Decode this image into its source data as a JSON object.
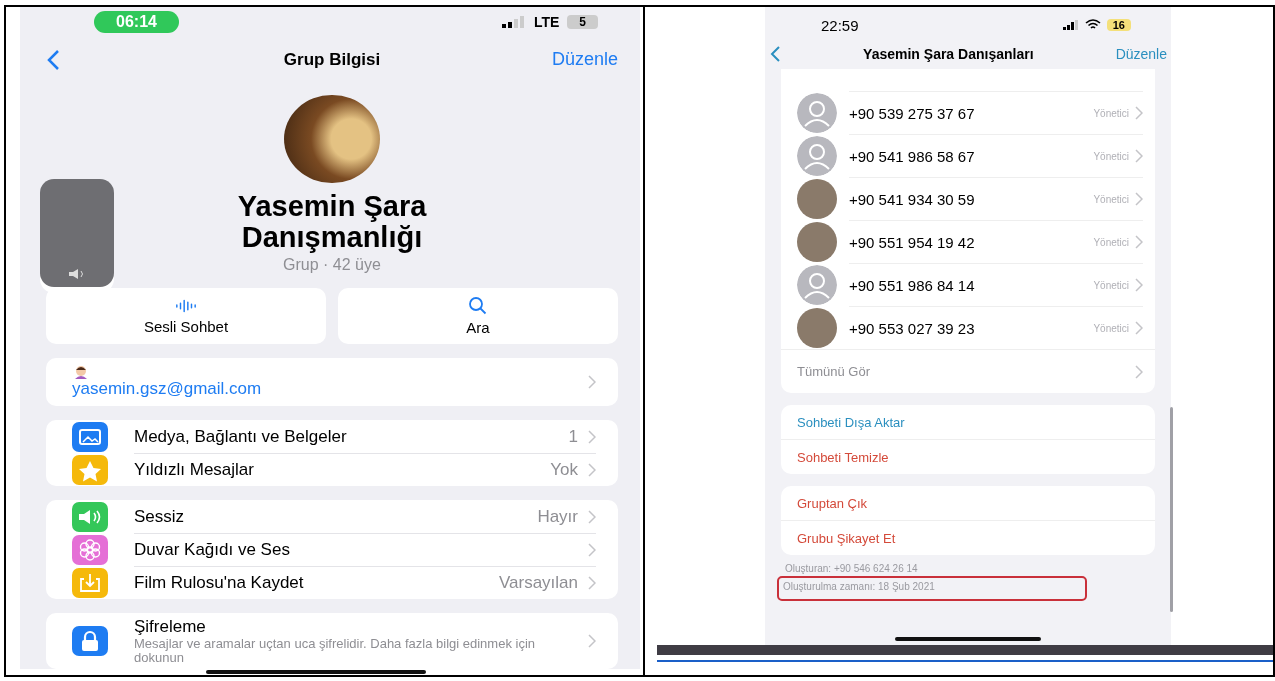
{
  "left_phone": {
    "status_bar": {
      "time": "06:14",
      "network": "LTE",
      "battery": "5"
    },
    "nav": {
      "title": "Grup Bilgisi",
      "action": "Düzenle"
    },
    "group": {
      "name": "Yasemin Şara Danışmanlığı",
      "subtitle": "Grup · 42 üye"
    },
    "quick_actions": [
      {
        "kind": "voice",
        "label": "Sesli Sohbet"
      },
      {
        "kind": "search",
        "label": "Ara"
      }
    ],
    "description": "yasemin.gsz@gmail.com",
    "sections": [
      [
        {
          "kind": "media",
          "label": "Medya, Bağlantı ve Belgeler",
          "value": "1"
        },
        {
          "kind": "star",
          "label": "Yıldızlı Mesajlar",
          "value": "Yok"
        }
      ],
      [
        {
          "kind": "sound",
          "label": "Sessiz",
          "value": "Hayır"
        },
        {
          "kind": "flower",
          "label": "Duvar Kağıdı ve Ses"
        },
        {
          "kind": "save",
          "label": "Film Rulosu'na Kaydet",
          "value": "Varsayılan"
        }
      ]
    ],
    "encryption": {
      "title": "Şifreleme",
      "text": "Mesajlar ve aramalar uçtan uca şifrelidir. Daha fazla bilgi edinmek için dokunun"
    }
  },
  "right_phone": {
    "status_bar": {
      "time": "22:59",
      "battery": "16"
    },
    "nav": {
      "title": "Yasemin Şara Danışanları",
      "action": "Düzenle"
    },
    "members": [
      {
        "has_photo": false,
        "phone": "+90 539 275 37 67",
        "role": "Yönetici"
      },
      {
        "has_photo": false,
        "phone": "+90 541 986 58 67",
        "role": "Yönetici"
      },
      {
        "has_photo": true,
        "phone": "+90 541 934 30 59",
        "role": "Yönetici"
      },
      {
        "has_photo": true,
        "phone": "+90 551 954 19 42",
        "role": "Yönetici"
      },
      {
        "has_photo": false,
        "phone": "+90 551 986 84 14",
        "role": "Yönetici"
      },
      {
        "has_photo": true,
        "phone": "+90 553 027 39 23",
        "role": "Yönetici"
      }
    ],
    "see_all": "Tümünü Gör",
    "action_groups": [
      [
        {
          "kind": "normal",
          "label": "Sohbeti Dışa Aktar"
        },
        {
          "kind": "destructive",
          "label": "Sohbeti Temizle"
        }
      ],
      [
        {
          "kind": "destructive",
          "label": "Gruptan Çık"
        },
        {
          "kind": "destructive",
          "label": "Grubu Şikayet Et"
        }
      ]
    ],
    "footer": [
      {
        "text": "Oluşturan: +90 546 624 26 14",
        "highlighted": false
      },
      {
        "text": "Oluşturulma zamanı: 18 Şub 2021",
        "highlighted": true
      }
    ]
  }
}
